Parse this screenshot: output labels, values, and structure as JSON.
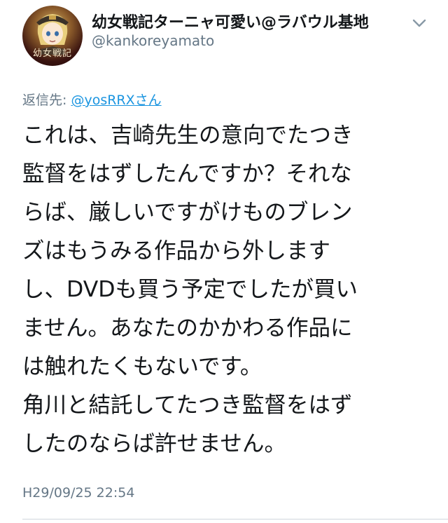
{
  "user": {
    "display_name": "幼女戦記ターニャ可愛い@ラバウル基地",
    "handle": "@kankoreyamato",
    "avatar_text": "幼女戦記"
  },
  "reply": {
    "prefix": "返信先: ",
    "to": "@yosRRXさん"
  },
  "tweet": {
    "lines": [
      "これは、吉崎先生の意向でたつき",
      "監督をはずしたんですか？それな",
      "らば、厳しいですがけものブレン",
      "ズはもうみる作品から外します",
      "し、DVDも買う予定でしたが買い",
      "ません。あなたのかかわる作品に",
      "は触れたくもないです。",
      "角川と結託してたつき監督をはず",
      "したのならば許せません。"
    ],
    "timestamp": "H29/09/25 22:54"
  },
  "icons": {
    "menu": "chevron-down-icon"
  },
  "colors": {
    "text": "#14171a",
    "muted": "#657786",
    "link": "#1b95e0"
  }
}
